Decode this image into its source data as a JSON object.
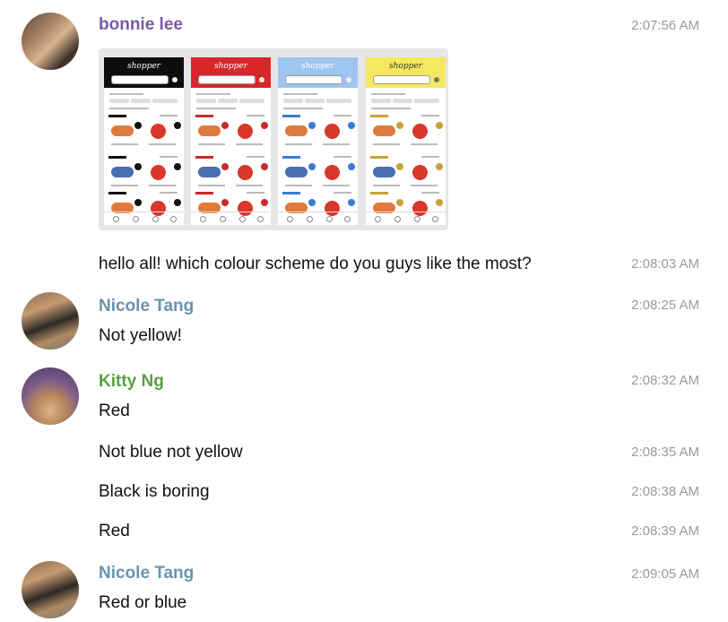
{
  "messages": [
    {
      "sender": "bonnie lee",
      "sender_color": "#7a5aa8",
      "avatar": "group-photo",
      "time": "2:07:56 AM",
      "attachment": {
        "type": "image",
        "panels": [
          {
            "bar_color": "#0d0d0d",
            "accent": "#111111",
            "logo": "shopper",
            "logo_color": "#ffffff"
          },
          {
            "bar_color": "#d8272b",
            "accent": "#c92a2a",
            "logo": "shopper",
            "logo_color": "#ffffff"
          },
          {
            "bar_color": "#9dc5ef",
            "accent": "#3a7bd5",
            "logo": "shopper",
            "logo_color": "#ffffff"
          },
          {
            "bar_color": "#f4e95c",
            "accent": "#c8a13a",
            "logo": "shopper",
            "logo_color": "#333333"
          }
        ]
      }
    },
    {
      "text": "hello all! which colour scheme do you guys like the most?",
      "time": "2:08:03 AM"
    },
    {
      "sender": "Nicole Tang",
      "sender_color": "#6a93ad",
      "avatar": "group-photo",
      "time": "2:08:25 AM",
      "text": "Not yellow!"
    },
    {
      "sender": "Kitty Ng",
      "sender_color": "#5a9e44",
      "avatar": "selfie-with-dog",
      "time": "2:08:32 AM",
      "text": "Red"
    },
    {
      "text": "Not blue not yellow",
      "time": "2:08:35 AM"
    },
    {
      "text": "Black is boring",
      "time": "2:08:38 AM"
    },
    {
      "text": "Red",
      "time": "2:08:39 AM"
    },
    {
      "sender": "Nicole Tang",
      "sender_color": "#6a93ad",
      "avatar": "group-photo",
      "time": "2:09:05 AM",
      "text": "Red or blue"
    }
  ]
}
